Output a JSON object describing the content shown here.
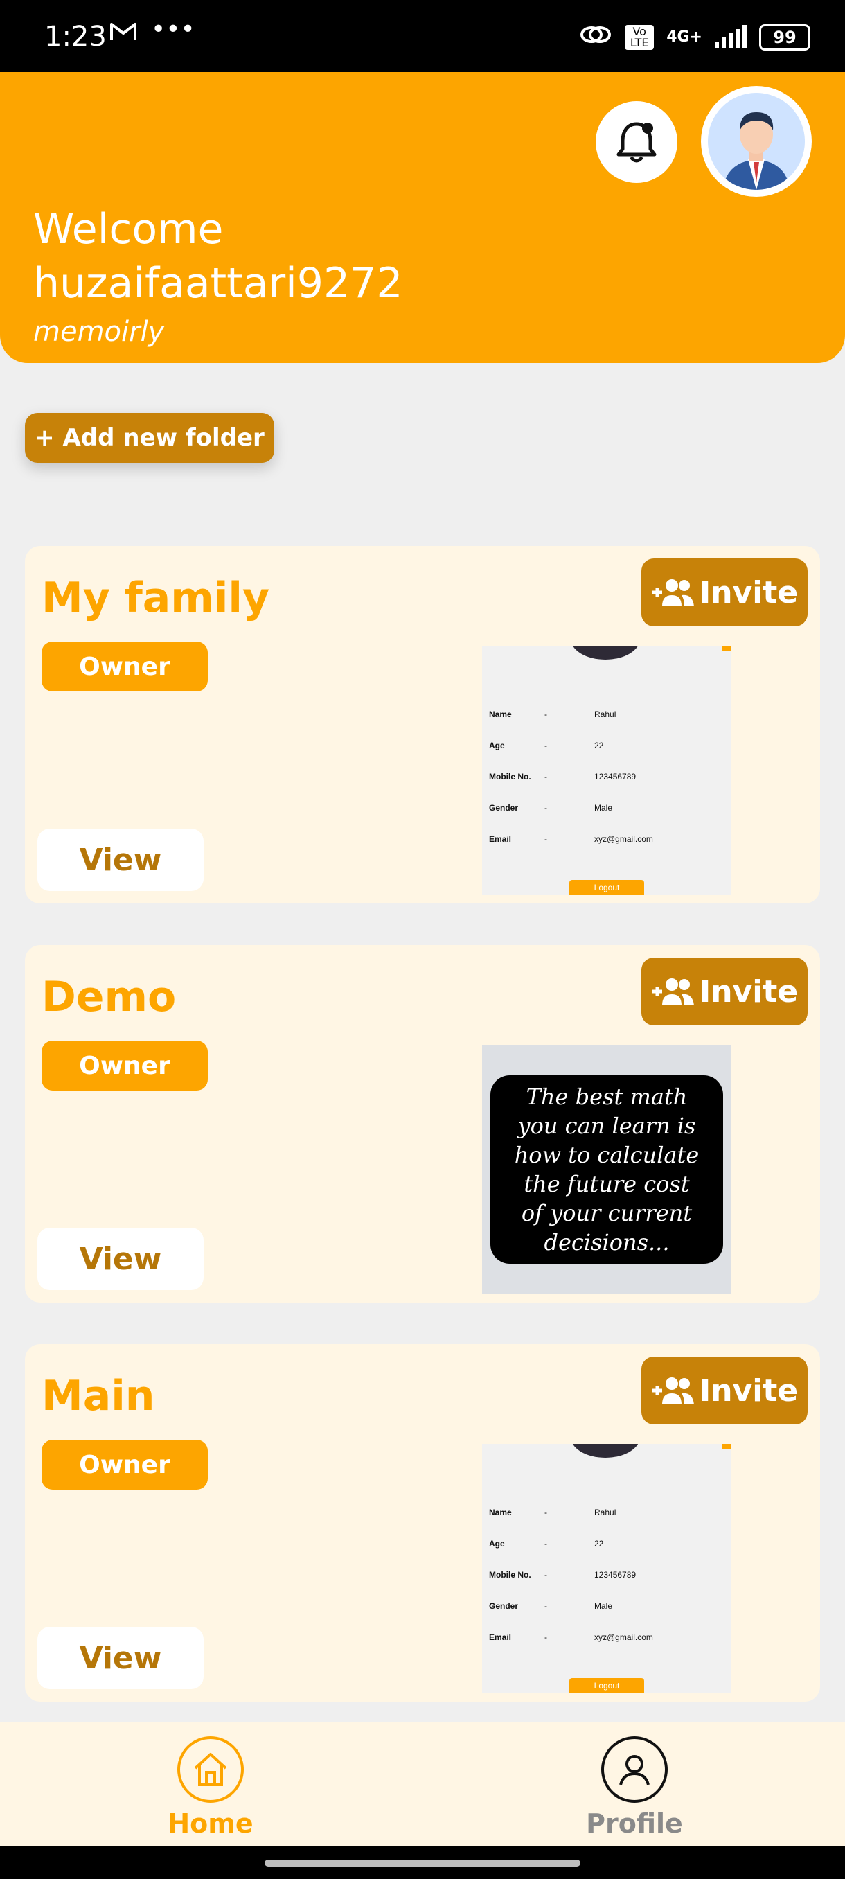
{
  "status_bar": {
    "time": "1:23",
    "notification_icons": [
      "gmail-icon",
      "more-icon"
    ],
    "battery": "99",
    "network": "4G+",
    "volte": "Vo LTE"
  },
  "header": {
    "welcome_line1": "Welcome",
    "welcome_line2": "huzaifaattari9272",
    "brand": "memoirly",
    "accent_color": "#fda500"
  },
  "actions": {
    "add_folder_label": "+ Add new folder"
  },
  "folders": [
    {
      "title": "My family",
      "role": "Owner",
      "invite_label": "Invite",
      "view_label": "View",
      "thumbnail": {
        "type": "profile",
        "rows": [
          {
            "label": "Name",
            "dash": "-",
            "value": "Rahul"
          },
          {
            "label": "Age",
            "dash": "-",
            "value": "22"
          },
          {
            "label": "Mobile No.",
            "dash": "-",
            "value": "123456789"
          },
          {
            "label": "Gender",
            "dash": "-",
            "value": "Male"
          },
          {
            "label": "Email",
            "dash": "-",
            "value": "xyz@gmail.com"
          }
        ],
        "button": "Logout"
      }
    },
    {
      "title": "Demo",
      "role": "Owner",
      "invite_label": "Invite",
      "view_label": "View",
      "thumbnail": {
        "type": "quote",
        "lines": [
          "The best math",
          "you can learn is",
          "how to calculate",
          "the future cost",
          "of your current",
          "decisions..."
        ]
      }
    },
    {
      "title": "Main",
      "role": "Owner",
      "invite_label": "Invite",
      "view_label": "View",
      "thumbnail": {
        "type": "profile",
        "rows": [
          {
            "label": "Name",
            "dash": "-",
            "value": "Rahul"
          },
          {
            "label": "Age",
            "dash": "-",
            "value": "22"
          },
          {
            "label": "Mobile No.",
            "dash": "-",
            "value": "123456789"
          },
          {
            "label": "Gender",
            "dash": "-",
            "value": "Male"
          },
          {
            "label": "Email",
            "dash": "-",
            "value": "xyz@gmail.com"
          }
        ],
        "button": "Logout"
      }
    }
  ],
  "bottom_nav": {
    "home_label": "Home",
    "profile_label": "Profile",
    "active": "Home"
  }
}
